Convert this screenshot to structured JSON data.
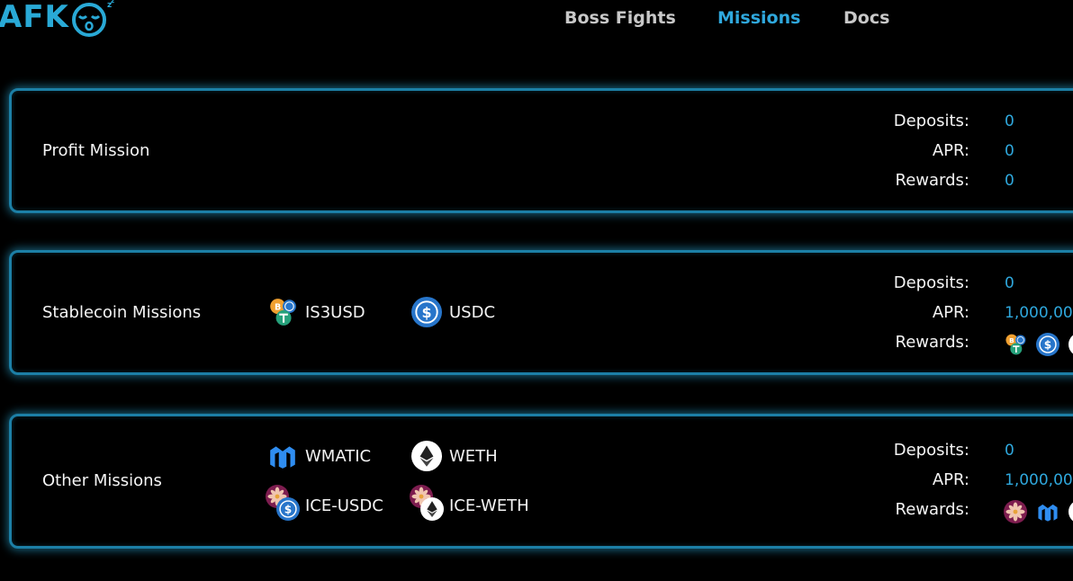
{
  "header": {
    "logo_text": "AFK",
    "nav": [
      {
        "label": "Boss Fights",
        "active": false
      },
      {
        "label": "Missions",
        "active": true
      },
      {
        "label": "Docs",
        "active": false
      }
    ]
  },
  "colors": {
    "accent": "#2fa8dd",
    "panel_border": "#1c7fa6",
    "background": "#000000"
  },
  "labels": {
    "deposits": "Deposits:",
    "apr": "APR:",
    "rewards": "Rewards:"
  },
  "missions": [
    {
      "title": "Profit Mission",
      "tokens": [],
      "deposits": "0",
      "apr": "0",
      "rewards": "0"
    },
    {
      "title": "Stablecoin Missions",
      "tokens": [
        {
          "label": "IS3USD",
          "icon": "is3usd-icon"
        },
        {
          "label": "USDC",
          "icon": "usdc-icon"
        }
      ],
      "deposits": "0",
      "apr": "1,000,00",
      "reward_icons": [
        "is3usd-icon",
        "usdc-icon"
      ]
    },
    {
      "title": "Other Missions",
      "tokens": [
        {
          "label": "WMATIC",
          "icon": "matic-icon"
        },
        {
          "label": "WETH",
          "icon": "eth-icon"
        },
        {
          "label": "ICE-USDC",
          "icon": "ice-usdc-icon"
        },
        {
          "label": "ICE-WETH",
          "icon": "ice-weth-icon"
        }
      ],
      "deposits": "0",
      "apr": "1,000,00",
      "reward_icons": [
        "ice-icon",
        "matic-icon",
        "eth-icon"
      ]
    }
  ]
}
